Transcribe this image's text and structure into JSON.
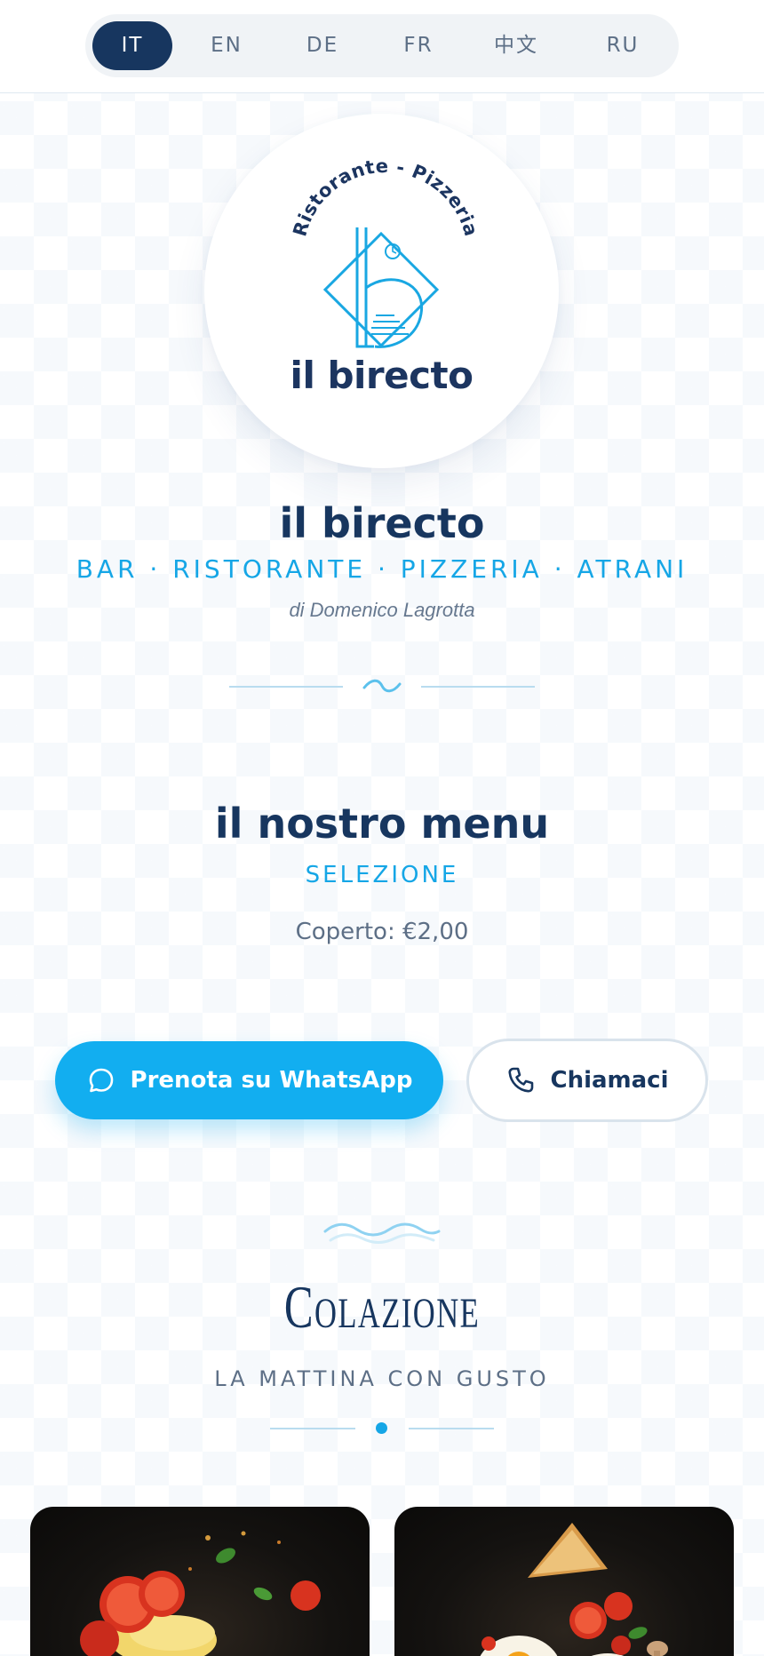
{
  "languages": {
    "items": [
      {
        "label": "IT",
        "active": true
      },
      {
        "label": "EN",
        "active": false
      },
      {
        "label": "DE",
        "active": false
      },
      {
        "label": "FR",
        "active": false
      },
      {
        "label": "中文",
        "active": false
      },
      {
        "label": "RU",
        "active": false
      }
    ]
  },
  "logo": {
    "arc_text": "Ristorante - Pizzeria",
    "wordmark": "il birecto"
  },
  "header": {
    "name": "il birecto",
    "tagline": "BAR · RISTORANTE · PIZZERIA · ATRANI",
    "owner": "di Domenico Lagrotta"
  },
  "menu": {
    "title": "il nostro menu",
    "subtitle": "SELEZIONE",
    "cover": "Coperto: €2,00"
  },
  "actions": {
    "whatsapp_label": "Prenota su WhatsApp",
    "call_label": "Chiamaci"
  },
  "section": {
    "title": "Colazione",
    "subtitle": "LA MATTINA CON GUSTO"
  },
  "icons": {
    "whatsapp": "chat-bubble-icon",
    "call": "phone-icon",
    "divider": "wave-icon"
  },
  "colors": {
    "primary": "#17365f",
    "accent": "#12aef0",
    "muted": "#5d6f86"
  }
}
